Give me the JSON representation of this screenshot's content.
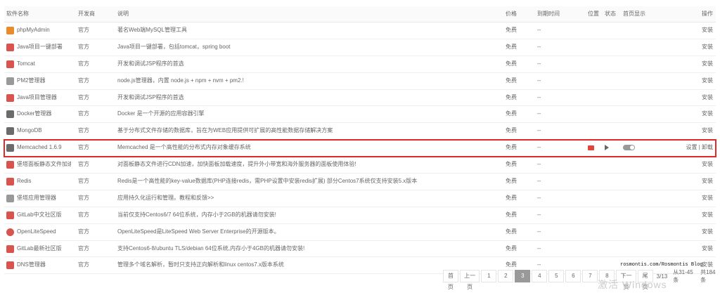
{
  "headers": {
    "name": "软件名称",
    "dev": "开发商",
    "desc": "说明",
    "price": "价格",
    "expire": "到期时间",
    "position": "位置",
    "status": "状态",
    "home": "首页显示",
    "op": "操作"
  },
  "rows": [
    {
      "name": "phpMyAdmin",
      "dev": "官方",
      "desc": "著名Web端MySQL管理工具",
      "price": "免费",
      "expire": "--",
      "op": "安装",
      "icon": "phpmyadmin-icon"
    },
    {
      "name": "Java项目一键部署",
      "dev": "官方",
      "desc": "Java项目一键部署，包括tomcat，spring boot",
      "price": "免费",
      "expire": "--",
      "op": "安装",
      "icon": "java-icon"
    },
    {
      "name": "Tomcat",
      "dev": "官方",
      "desc": "开发和调试JSP程序的首选",
      "price": "免费",
      "expire": "--",
      "op": "安装",
      "icon": "tomcat-icon"
    },
    {
      "name": "PM2管理器",
      "dev": "官方",
      "desc": "node.js管理器，内置 node.js + npm + nvm + pm2.!",
      "price": "免费",
      "expire": "--",
      "op": "安装",
      "icon": "pm2-icon"
    },
    {
      "name": "Java项目管理器",
      "dev": "官方",
      "desc": "开发和调试JSP程序的首选",
      "price": "免费",
      "expire": "--",
      "op": "安装",
      "icon": "java-icon"
    },
    {
      "name": "Docker管理器",
      "dev": "官方",
      "desc": "Docker 是一个开源的应用容器引擎",
      "price": "免费",
      "expire": "--",
      "op": "安装",
      "icon": "docker-icon"
    },
    {
      "name": "MongoDB",
      "dev": "官方",
      "desc": "基于分布式文件存储的数据库，旨在为WEB应用提供可扩展的高性能数据存储解决方案",
      "price": "免费",
      "expire": "--",
      "op": "安装",
      "icon": "mongodb-icon"
    },
    {
      "name": "Memcached 1.6.9",
      "dev": "官方",
      "desc": "Memcached 是一个高性能的分布式内存对象缓存系统",
      "price": "免费",
      "expire": "--",
      "op": "设置 | 卸载",
      "icon": "memcached-icon",
      "installed": true
    },
    {
      "name": "堡塔面板静态文件加速",
      "dev": "官方",
      "desc": "对面板静态文件进行CDN加速，加快面板加载速度，提升外小带宽和海外服务器的面板使用体验!",
      "price": "免费",
      "expire": "--",
      "op": "安装",
      "icon": "cdn-icon"
    },
    {
      "name": "Redis",
      "dev": "官方",
      "desc": "Redis是一个高性能的key-value数据库(PHP连接redis，需PHP设置中安装redis扩展) 部分Centos7系统仅支持安装5.x版本",
      "price": "免费",
      "expire": "--",
      "op": "安装",
      "icon": "redis-icon"
    },
    {
      "name": "堡塔应用管理器",
      "dev": "官方",
      "desc": "应用持久化运行和管理。教程和反馈>>",
      "price": "免费",
      "expire": "--",
      "op": "安装",
      "icon": "app-manager-icon"
    },
    {
      "name": "GitLab中文社区版",
      "dev": "官方",
      "desc": "当前仅支持Centos6/7 64位系统，内存小于2GB的机器请勿安装!",
      "price": "免费",
      "expire": "--",
      "op": "安装",
      "icon": "gitlab-icon"
    },
    {
      "name": "OpenLiteSpeed",
      "dev": "官方",
      "desc": "OpenLiteSpeed是LiteSpeed Web Server Enterprise的开源版本。",
      "price": "免费",
      "expire": "--",
      "op": "安装",
      "icon": "openlitespeed-icon"
    },
    {
      "name": "GitLab最新社区版",
      "dev": "官方",
      "desc": "支持Centos6-8/ubuntu TLS/debian 64位系统,内存小于4GB的机器请勿安装!",
      "price": "免费",
      "expire": "--",
      "op": "安装",
      "icon": "gitlab-icon"
    },
    {
      "name": "DNS管理器",
      "dev": "官方",
      "desc": "管理多个域名解析，暂时只支持正向解析和linux centos7.x版本系统",
      "price": "免费",
      "expire": "--",
      "op": "安装",
      "icon": "dns-icon"
    }
  ],
  "pager": {
    "first": "首页",
    "prev": "上一页",
    "pages": [
      "1",
      "2",
      "3",
      "4",
      "5",
      "6",
      "7",
      "8"
    ],
    "current": "3",
    "next": "下一页",
    "last": "尾页",
    "info": "3/13",
    "range": "从31-45条",
    "total": "共184条"
  },
  "watermark": {
    "blog": "rosmontis.com/Rosmontis Blog",
    "activate": "激活 Windows"
  }
}
